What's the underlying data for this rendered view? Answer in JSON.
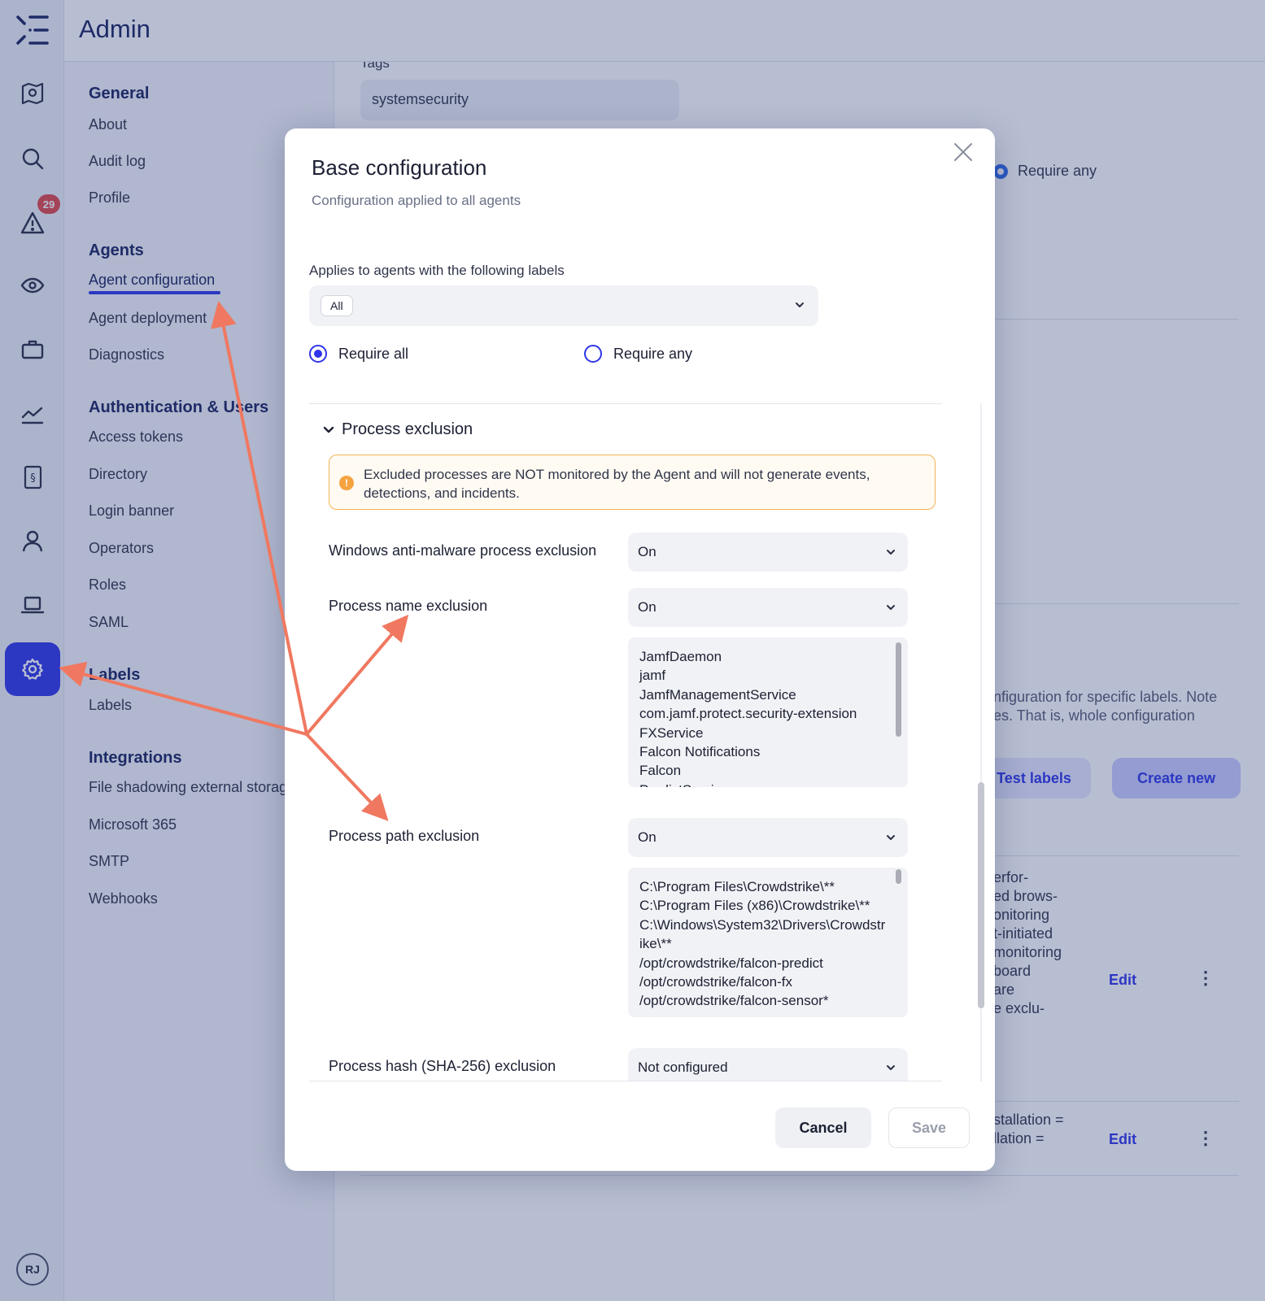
{
  "app": {
    "title": "Admin",
    "notification_count": "29",
    "user_initials": "RJ"
  },
  "rail": {
    "icons": [
      "map-icon",
      "search-icon",
      "alert-icon",
      "eye-icon",
      "briefcase-icon",
      "chart-icon",
      "compliance-icon",
      "user-icon",
      "laptop-icon",
      "settings-icon"
    ]
  },
  "nav": {
    "general": {
      "heading": "General",
      "items": [
        "About",
        "Audit log",
        "Profile"
      ]
    },
    "agents": {
      "heading": "Agents",
      "items": [
        "Agent configuration",
        "Agent deployment",
        "Diagnostics"
      ]
    },
    "auth": {
      "heading": "Authentication & Users",
      "items": [
        "Access tokens",
        "Directory",
        "Login banner",
        "Operators",
        "Roles",
        "SAML"
      ]
    },
    "labels": {
      "heading": "Labels",
      "items": [
        "Labels"
      ]
    },
    "integrations": {
      "heading": "Integrations",
      "items": [
        "File shadowing external storag",
        "Microsoft 365",
        "SMTP",
        "Webhooks"
      ]
    }
  },
  "background": {
    "tags_label": "Tags",
    "tags_value": "systemsecurity",
    "require_any": "Require any",
    "description": "nfiguration for specific labels. Note\nes. That is, whole configuration",
    "test_labels": "Test labels",
    "create_new": "Create new",
    "row1_text": "erfor-\ned brows-\nonitoring\nt-initiated\nmonitoring\nboard\nare\ne exclu-",
    "row2_text": "stallation =\nllation =",
    "edit": "Edit",
    "more": "⋮"
  },
  "modal": {
    "title": "Base configuration",
    "subtitle": "Configuration applied to all agents",
    "labels_label": "Applies to agents with the following labels",
    "labels_chip": "All",
    "require_all": "Require all",
    "require_any": "Require any",
    "section_title": "Process exclusion",
    "warning": "Excluded processes are NOT monitored by the Agent and will not generate events, detections, and incidents.",
    "rows": {
      "windows": {
        "label": "Windows anti-malware process exclusion",
        "value": "On"
      },
      "name": {
        "label": "Process name exclusion",
        "value": "On",
        "list": "JamfDaemon\njamf\nJamfManagementService\ncom.jamf.protect.security-extension\nFXService\nFalcon Notifications\nFalcon\nPredictService"
      },
      "path": {
        "label": "Process path exclusion",
        "value": "On",
        "list": "C:\\Program Files\\Crowdstrike\\**\nC:\\Program Files (x86)\\Crowdstrike\\**\nC:\\Windows\\System32\\Drivers\\Crowdstrike\\**\n/opt/crowdstrike/falcon-predict\n/opt/crowdstrike/falcon-fx\n/opt/crowdstrike/falcon-sensor*"
      },
      "hash": {
        "label": "Process hash (SHA-256) exclusion",
        "value": "Not configured"
      }
    },
    "cancel": "Cancel",
    "save": "Save"
  },
  "colors": {
    "accent": "#2f36e8",
    "arrow": "#f07860",
    "warning_border": "#f2b458",
    "badge": "#e0484a"
  }
}
